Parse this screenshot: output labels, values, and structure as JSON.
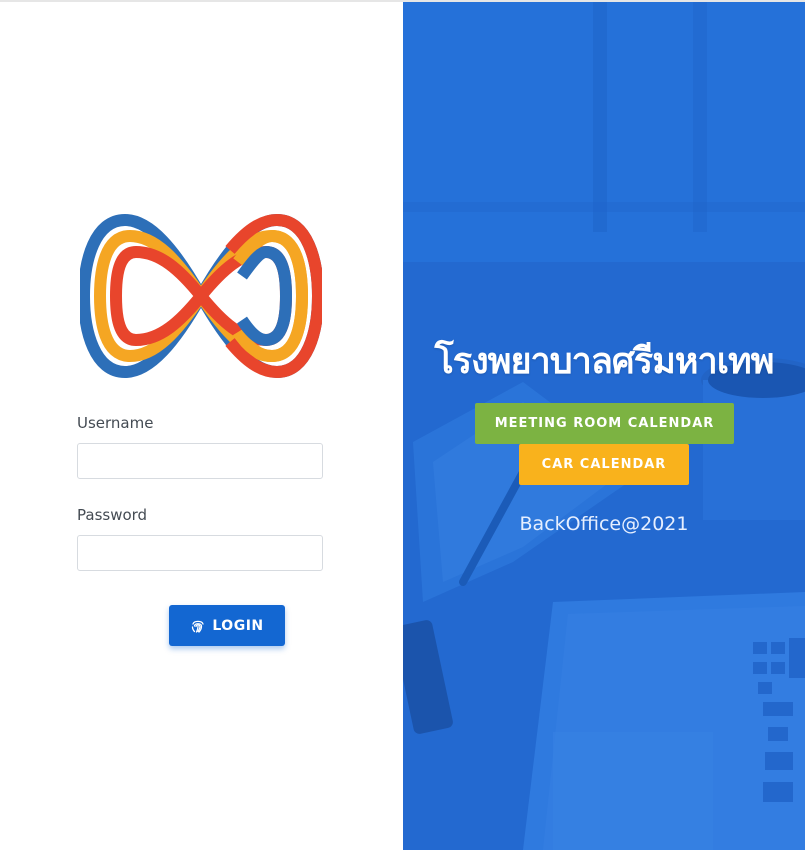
{
  "login_form": {
    "username_label": "Username",
    "username_value": "",
    "password_label": "Password",
    "password_value": "",
    "login_button": "LOGIN",
    "login_icon": "fingerprint-icon"
  },
  "logo": {
    "icon": "infinity-logo",
    "colors": [
      "#2d6fb8",
      "#f5a623",
      "#e8452c"
    ]
  },
  "hero": {
    "hospital_name": "โรงพยาบาลศรีมหาเทพ",
    "meeting_room_button": "MEETING ROOM CALENDAR",
    "car_calendar_button": "CAR CALENDAR",
    "footer": "BackOffice@2021"
  },
  "colors": {
    "primary": "#1367d2",
    "hero_overlay": "#2a72d6",
    "meeting_button": "#7cb342",
    "car_button": "#f9b21c"
  }
}
